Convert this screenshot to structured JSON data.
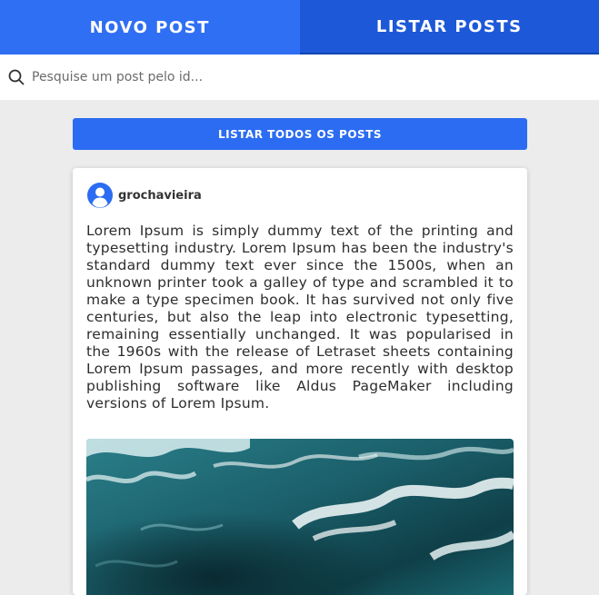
{
  "tabs": {
    "new_post": "NOVO POST",
    "list_posts": "LISTAR POSTS"
  },
  "search": {
    "placeholder": "Pesquise um post pelo id...",
    "icon": "search-icon"
  },
  "list_all_button": "LISTAR TODOS OS POSTS",
  "post": {
    "author": "grochavieira",
    "avatar_icon": "user-circle-icon",
    "text": "Lorem Ipsum is simply dummy text of the printing and typesetting industry. Lorem Ipsum has been the industry's standard dummy text ever since the 1500s, when an unknown printer took a galley of type and scrambled it to make a type specimen book. It has survived not only five centuries, but also the leap into electronic typesetting, remaining essentially unchanged. It was popularised in the 1960s with the release of Letraset sheets containing Lorem Ipsum passages, and more recently with desktop publishing software like Aldus PageMaker including versions of Lorem Ipsum."
  },
  "colors": {
    "tab_new": "#2f6ff4",
    "tab_list": "#1d58d8",
    "button": "#2b6cf2",
    "background": "#ececec"
  }
}
